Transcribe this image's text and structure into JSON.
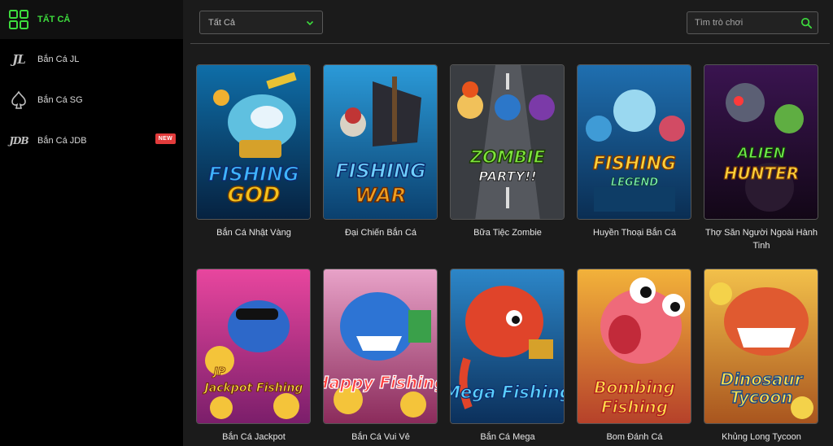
{
  "sidebar": {
    "items": [
      {
        "label": "TẤT CẢ",
        "icon": "grid-icon",
        "active": true
      },
      {
        "label": "Bắn Cá JL",
        "icon": "jl-logo-icon",
        "logo_text": "JL"
      },
      {
        "label": "Bắn Cá SG",
        "icon": "spade-icon"
      },
      {
        "label": "Bắn Cá JDB",
        "icon": "jdb-logo-icon",
        "logo_text": "JDB",
        "badge": "NEW"
      }
    ]
  },
  "filter": {
    "selected": "Tất Cả",
    "icon": "chevron-down-icon"
  },
  "search": {
    "placeholder": "Tìm trò chơi",
    "icon": "search-icon"
  },
  "games": [
    {
      "title": "Bắn Cá Nhật Vàng",
      "logo_line1": "FISHING",
      "logo_line2": "GOD"
    },
    {
      "title": "Đại Chiến Bắn Cá",
      "logo_line1": "FISHING",
      "logo_line2": "WAR"
    },
    {
      "title": "Bữa Tiệc Zombie",
      "logo_line1": "ZOMBIE",
      "logo_line2": "PARTY!!"
    },
    {
      "title": "Huyền Thoại Bắn Cá",
      "logo_line1": "FISHING",
      "logo_line2": "LEGEND"
    },
    {
      "title": "Thợ Săn Người Ngoài Hành Tinh",
      "logo_line1": "ALIEN",
      "logo_line2": "HUNTER"
    },
    {
      "title": "Bắn Cá Jackpot",
      "logo_line1": "JP",
      "logo_line2": "Jackpot Fishing"
    },
    {
      "title": "Bắn Cá Vui Vẻ",
      "logo_line1": "Happy Fishing",
      "logo_line2": ""
    },
    {
      "title": "Bắn Cá Mega",
      "logo_line1": "Mega Fishing",
      "logo_line2": ""
    },
    {
      "title": "Bom Đánh Cá",
      "logo_line1": "Bombing",
      "logo_line2": "Fishing"
    },
    {
      "title": "Khủng Long Tycoon",
      "logo_line1": "Dinosaur",
      "logo_line2": "Tycoon"
    }
  ],
  "colors": {
    "accent": "#3ddc3d",
    "badge": "#e23b3b",
    "background": "#1b1b1b",
    "sidebar": "#000000"
  }
}
